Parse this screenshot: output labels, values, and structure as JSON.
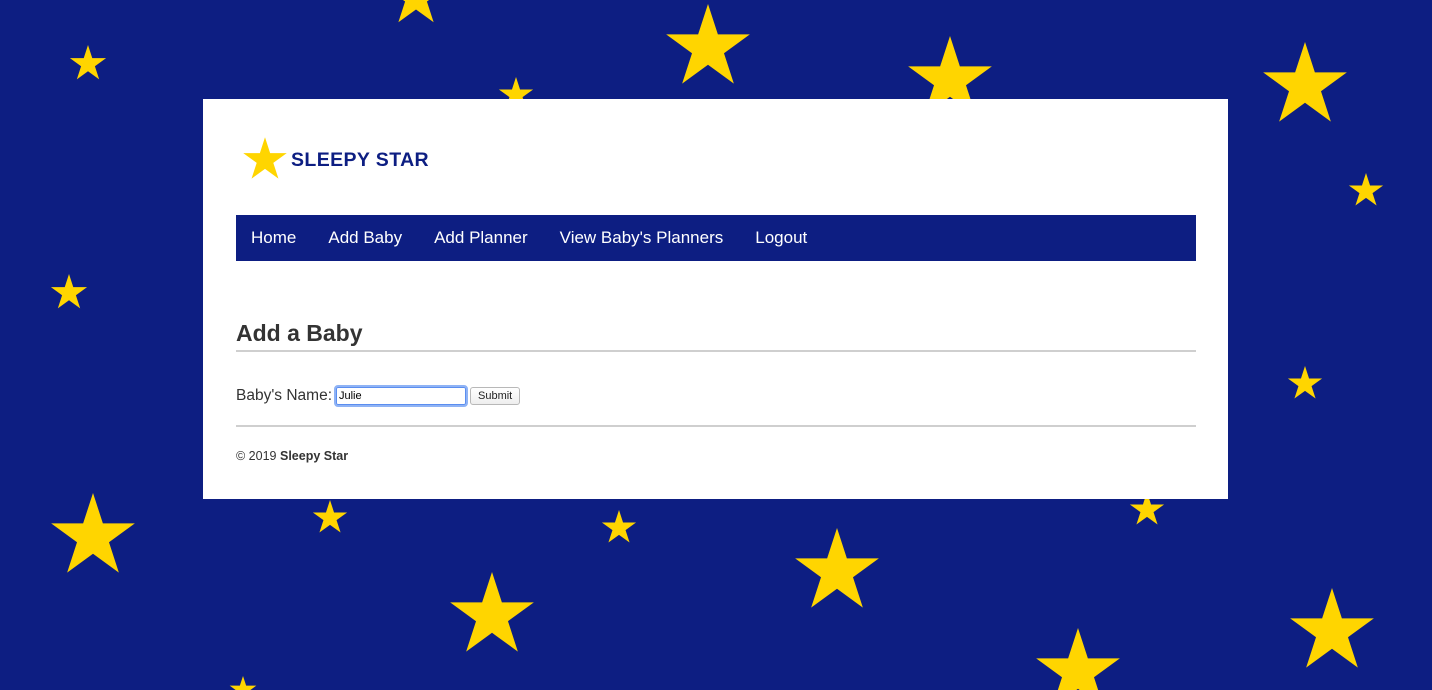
{
  "colors": {
    "background": "#0d1e82",
    "star": "#ffd500",
    "nav_background": "#0d1e82",
    "nav_text": "#ffffff",
    "heading_text": "#333333",
    "divider": "#cfcfcf"
  },
  "header": {
    "logo_icon": "star-icon",
    "logo_text": "SLEEPY STAR"
  },
  "nav": {
    "items": [
      {
        "label": "Home"
      },
      {
        "label": "Add Baby"
      },
      {
        "label": "Add Planner"
      },
      {
        "label": "View Baby's Planners"
      },
      {
        "label": "Logout"
      }
    ]
  },
  "main": {
    "title": "Add a Baby",
    "form": {
      "name_label": "Baby's Name:",
      "name_value": "Julie",
      "submit_label": "Submit"
    }
  },
  "footer": {
    "copyright": "© 2019",
    "brand": "Sleepy Star"
  }
}
